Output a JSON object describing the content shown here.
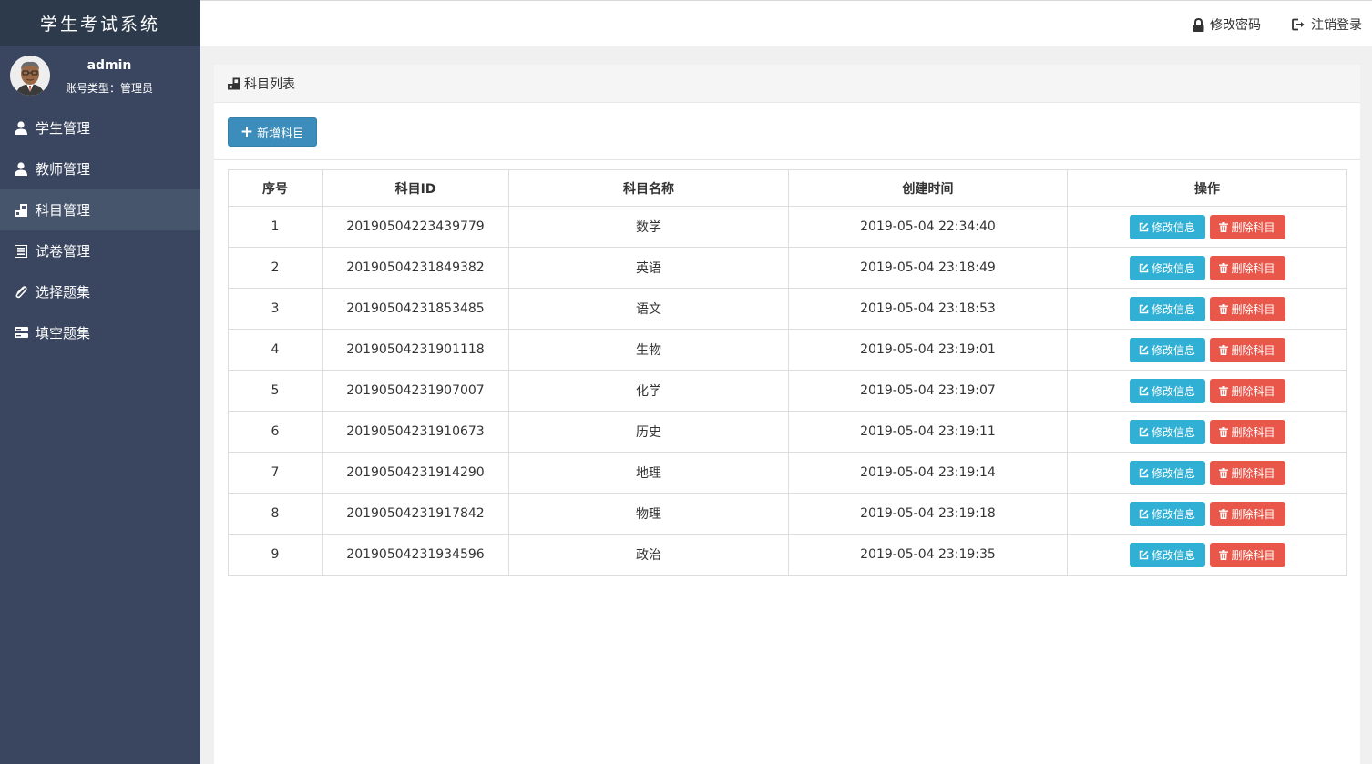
{
  "app": {
    "title": "学生考试系统"
  },
  "user": {
    "name": "admin",
    "role": "账号类型：管理员"
  },
  "sidebar": {
    "items": [
      {
        "label": "学生管理",
        "icon": "user-icon"
      },
      {
        "label": "教师管理",
        "icon": "user-icon"
      },
      {
        "label": "科目管理",
        "icon": "subject-icon",
        "active": true
      },
      {
        "label": "试卷管理",
        "icon": "list-icon"
      },
      {
        "label": "选择题集",
        "icon": "paperclip-icon"
      },
      {
        "label": "填空题集",
        "icon": "server-icon"
      }
    ]
  },
  "topbar": {
    "change_password": "修改密码",
    "logout": "注销登录"
  },
  "panel": {
    "title": "科目列表",
    "add_button": "新增科目"
  },
  "table": {
    "headers": [
      "序号",
      "科目ID",
      "科目名称",
      "创建时间",
      "操作"
    ],
    "edit_label": "修改信息",
    "delete_label": "删除科目",
    "rows": [
      [
        "1",
        "20190504223439779",
        "数学",
        "2019-05-04 22:34:40"
      ],
      [
        "2",
        "20190504231849382",
        "英语",
        "2019-05-04 23:18:49"
      ],
      [
        "3",
        "20190504231853485",
        "语文",
        "2019-05-04 23:18:53"
      ],
      [
        "4",
        "20190504231901118",
        "生物",
        "2019-05-04 23:19:01"
      ],
      [
        "5",
        "20190504231907007",
        "化学",
        "2019-05-04 23:19:07"
      ],
      [
        "6",
        "20190504231910673",
        "历史",
        "2019-05-04 23:19:11"
      ],
      [
        "7",
        "20190504231914290",
        "地理",
        "2019-05-04 23:19:14"
      ],
      [
        "8",
        "20190504231917842",
        "物理",
        "2019-05-04 23:19:18"
      ],
      [
        "9",
        "20190504231934596",
        "政治",
        "2019-05-04 23:19:35"
      ]
    ]
  },
  "colors": {
    "sidebar": "#3a4660",
    "brand_bar": "#2d3a4b",
    "primary": "#3c8dbc",
    "info": "#31b0d5",
    "danger": "#e8574a"
  }
}
